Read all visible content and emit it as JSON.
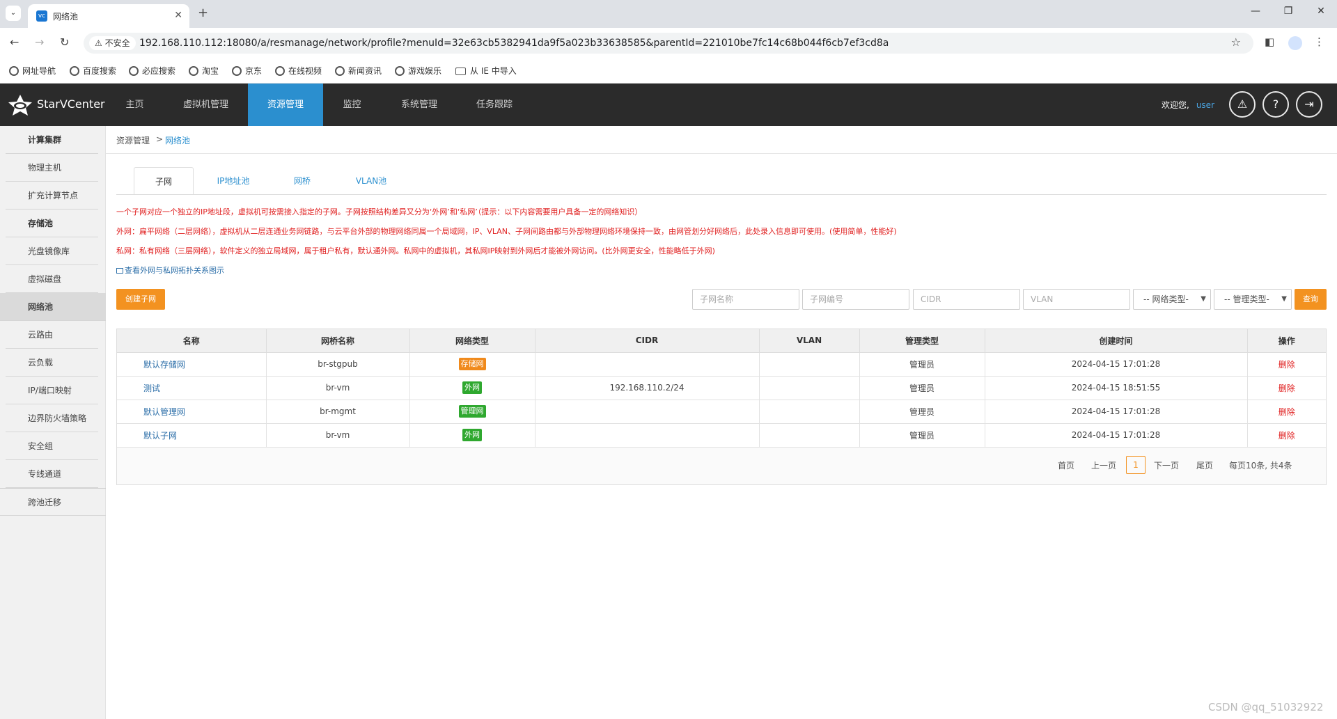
{
  "browser": {
    "tab_title": "网络池",
    "tab_favicon": "vc",
    "security_label": "不安全",
    "url": "192.168.110.112:18080/a/resmanage/network/profile?menuId=32e63cb5382941da9f5a023b33638585&parentId=221010be7fc14c68b044f6cb7ef3cd8a",
    "bookmarks": [
      "网址导航",
      "百度搜索",
      "必应搜索",
      "淘宝",
      "京东",
      "在线视频",
      "新闻资讯",
      "游戏娱乐",
      "从 IE 中导入"
    ]
  },
  "header": {
    "logo_text": "StarVCenter",
    "nav": [
      "主页",
      "虚拟机管理",
      "资源管理",
      "监控",
      "系统管理",
      "任务跟踪"
    ],
    "active_nav": "资源管理",
    "welcome": "欢迎您,",
    "username": "user"
  },
  "sidebar": {
    "items": [
      "计算集群",
      "物理主机",
      "扩充计算节点",
      "存储池",
      "光盘镜像库",
      "虚拟磁盘",
      "网络池",
      "云路由",
      "云负载",
      "IP/端口映射",
      "边界防火墙策略",
      "安全组",
      "专线通道",
      "跨池迁移"
    ],
    "active": "网络池"
  },
  "breadcrumb": {
    "root": "资源管理",
    "separator": ">",
    "current": "网络池"
  },
  "subtabs": [
    "子网",
    "IP地址池",
    "网桥",
    "VLAN池"
  ],
  "notes": [
    "一个子网对应一个独立的IP地址段，虚拟机可按需接入指定的子网。子网按照结构差异又分为‘外网’和‘私网’（提示：以下内容需要用户具备一定的网络知识）",
    "外网：扁平网络（二层网络），虚拟机从二层连通业务网链路，与云平台外部的物理网络同属一个局域网，IP、VLAN、子网间路由都与外部物理网络环境保持一致，由网管划分好网络后，此处录入信息即可使用。(使用简单，性能好)",
    "私网：私有网络（三层网络），软件定义的独立局域网，属于租户私有，默认通外网。私网中的虚拟机，其私网IP映射到外网后才能被外网访问。(比外网更安全，性能略低于外网)"
  ],
  "topology_link": "查看外网与私网拓扑关系图示",
  "toolbar": {
    "create_label": "创建子网",
    "placeholders": {
      "name": "子网名称",
      "code": "子网编号",
      "cidr": "CIDR",
      "vlan": "VLAN"
    },
    "network_type": "-- 网络类型-",
    "manage_type": "-- 管理类型-",
    "search_label": "查询"
  },
  "table": {
    "columns": [
      "名称",
      "网桥名称",
      "网络类型",
      "CIDR",
      "VLAN",
      "管理类型",
      "创建时间",
      "操作"
    ],
    "rows": [
      {
        "name": "默认存储网",
        "bridge": "br-stgpub",
        "type": "存储网",
        "type_color": "#f08a1c",
        "cidr": "",
        "vlan": "",
        "manage": "管理员",
        "created": "2024-04-15 17:01:28",
        "action": "删除"
      },
      {
        "name": "测试",
        "bridge": "br-vm",
        "type": "外网",
        "type_color": "#2fa82f",
        "cidr": "192.168.110.2/24",
        "vlan": "",
        "manage": "管理员",
        "created": "2024-04-15 18:51:55",
        "action": "删除"
      },
      {
        "name": "默认管理网",
        "bridge": "br-mgmt",
        "type": "管理网",
        "type_color": "#2fa82f",
        "cidr": "",
        "vlan": "",
        "manage": "管理员",
        "created": "2024-04-15 17:01:28",
        "action": "删除"
      },
      {
        "name": "默认子网",
        "bridge": "br-vm",
        "type": "外网",
        "type_color": "#2fa82f",
        "cidr": "",
        "vlan": "",
        "manage": "管理员",
        "created": "2024-04-15 17:01:28",
        "action": "删除"
      }
    ]
  },
  "pagination": {
    "first": "首页",
    "prev": "上一页",
    "current": "1",
    "next": "下一页",
    "last": "尾页",
    "summary": "每页10条, 共4条"
  },
  "watermark": "CSDN @qq_51032922",
  "colors": {
    "accent": "#2b8fcf",
    "header_bg": "#2b2b2b",
    "button_orange": "#f39220",
    "note_red": "#e02020"
  }
}
